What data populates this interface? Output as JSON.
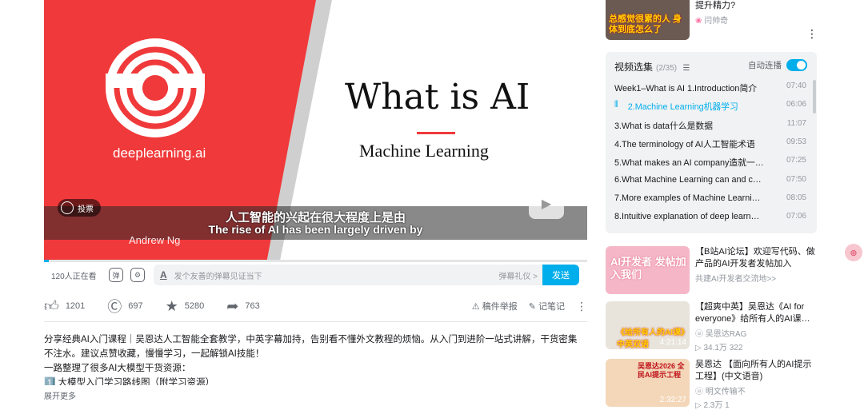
{
  "video": {
    "logo_text": "deeplearning.ai",
    "slide_title": "What is AI",
    "slide_subtitle": "Machine Learning",
    "author": "Andrew Ng",
    "subtitle_cn": "人工智能的兴起在很大程度上是由",
    "subtitle_en": "The rise of AI has been largely driven by",
    "vote_label": "投票"
  },
  "danmaku": {
    "viewers": "120人正在看",
    "placeholder": "发个友善的弹幕见证当下",
    "etiquette": "弹幕礼仪 >",
    "send": "发送"
  },
  "actions": {
    "like": "1201",
    "coin": "697",
    "favorite": "5280",
    "share": "763",
    "report": "稿件举报",
    "notes": "记笔记"
  },
  "description": {
    "text1": "分享经典AI入门课程｜吴恩达人工智能全套教学，中英字幕加持，告别看不懂外文教程的烦恼。从入门到进阶一站式讲解，干货密集不注水。建议点赞收藏，慢慢学习，一起解锁AI技能！",
    "text2": "一路整理了很多AI大模型干货资源：",
    "text3": "1️⃣ 大模型入门学习路线图（附学习资源）",
    "more": "展开更多"
  },
  "top_rec": {
    "title": "提升精力?",
    "author": "闫帅奇",
    "thumb_text": "总感觉很累的人 身体到底怎么了"
  },
  "playlist": {
    "title": "视频选集",
    "count": "(2/35)",
    "autoplay": "自动连播",
    "episodes": [
      {
        "title": "Week1–What is AI 1.Introduction简介",
        "duration": "07:40"
      },
      {
        "title": "2.Machine Learning机器学习",
        "duration": "06:06"
      },
      {
        "title": "3.What is data什么是数据",
        "duration": "11:07"
      },
      {
        "title": "4.The terminology of AI人工智能术语",
        "duration": "09:53"
      },
      {
        "title": "5.What makes an AI company造就一…",
        "duration": "07:25"
      },
      {
        "title": "6.What Machine Learning can and c…",
        "duration": "07:50"
      },
      {
        "title": "7.More examples of Machine Learni…",
        "duration": "08:05"
      },
      {
        "title": "8.Intuitive explanation of deep learn…",
        "duration": "07:06"
      }
    ]
  },
  "recs": [
    {
      "title": "【B站AI论坛】欢迎写代码、做产品的AI开发者发帖加入",
      "meta": "共建AI开发者交流地>>",
      "thumb_text": "AI开发者 发帖加入我们",
      "duration": ""
    },
    {
      "title": "【超爽中英】吴恩达《AI for everyone》给所有人的AI课…",
      "meta": "吴恩达RAG",
      "stats": "34.1万  322",
      "thumb_text": "《给所有人的AI课》 中英双语",
      "duration": "4:21:14"
    },
    {
      "title": "吴恩达 【面向所有人的AI提示工程】(中文语音)",
      "meta": "明文传输不",
      "stats": "2.3万  1",
      "thumb_text": "吴恩达2026 全民AI提示工程",
      "duration": "2:32:27"
    }
  ],
  "colors": {
    "accent": "#00aeec",
    "brand_red": "#f0393a"
  }
}
